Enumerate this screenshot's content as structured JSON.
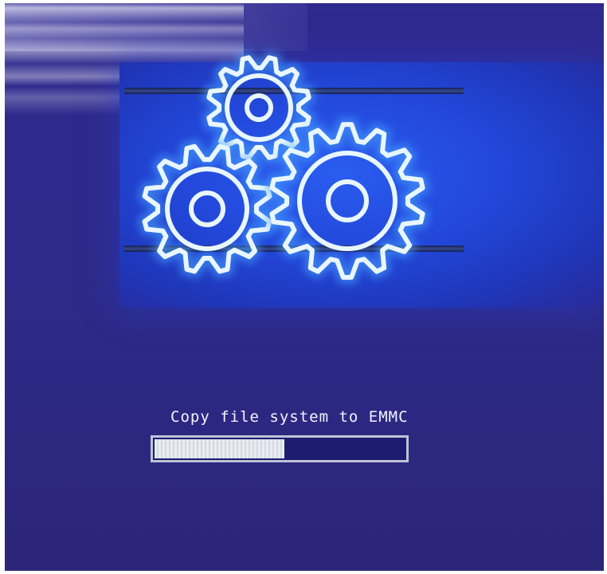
{
  "screen": {
    "status_text": "Copy file system to EMMC",
    "progress_fraction": 0.52,
    "icon": "gears-icon",
    "colors": {
      "background": "#2d2a88",
      "banner": "#2246d8",
      "gear_outline": "#e8f6ff",
      "progress_fill": "#e9ecf2",
      "progress_border": "#bfc3d6"
    }
  }
}
